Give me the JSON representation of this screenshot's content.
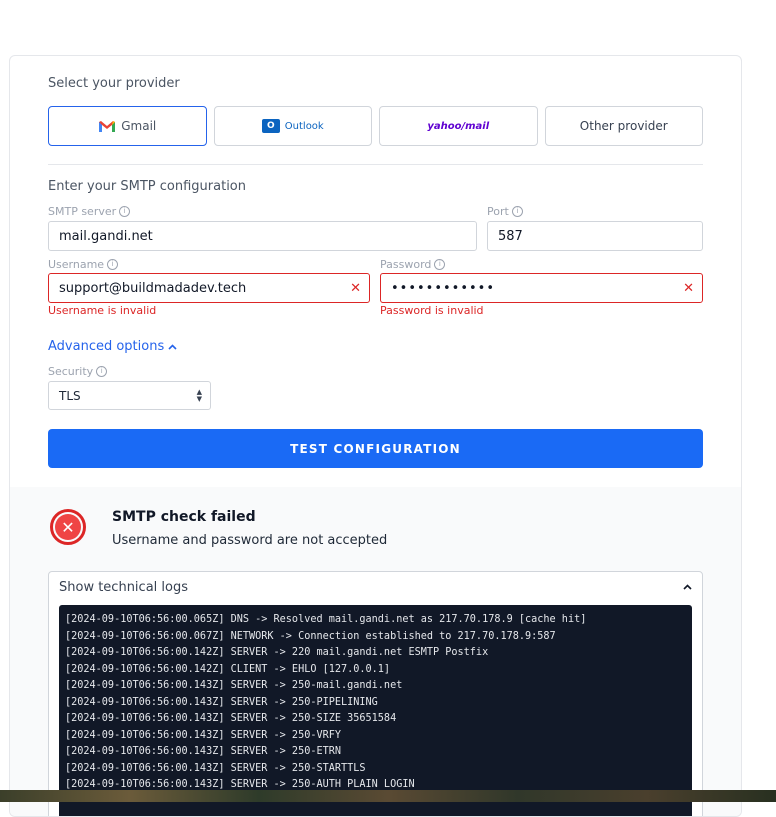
{
  "provider_section": {
    "label": "Select your provider",
    "options": [
      {
        "name": "Gmail",
        "selected": true
      },
      {
        "name": "Outlook",
        "selected": false
      },
      {
        "name": "yahoo/mail",
        "selected": false
      },
      {
        "name": "Other provider",
        "selected": false
      }
    ]
  },
  "smtp_section": {
    "label": "Enter your SMTP configuration",
    "server": {
      "label": "SMTP server",
      "value": "mail.gandi.net"
    },
    "port": {
      "label": "Port",
      "value": "587"
    },
    "username": {
      "label": "Username",
      "value": "support@buildmadadev.tech",
      "error": "Username is invalid"
    },
    "password": {
      "label": "Password",
      "value": "••••••••••••",
      "error": "Password is invalid"
    }
  },
  "advanced": {
    "toggle_label": "Advanced options",
    "security": {
      "label": "Security",
      "value": "TLS"
    }
  },
  "test_button": "TEST CONFIGURATION",
  "result": {
    "title": "SMTP check failed",
    "message": "Username and password are not accepted",
    "logs_toggle": "Show technical logs",
    "logs": [
      "[2024-09-10T06:56:00.065Z] DNS -> Resolved mail.gandi.net as 217.70.178.9 [cache hit]",
      "[2024-09-10T06:56:00.067Z] NETWORK -> Connection established to 217.70.178.9:587",
      "[2024-09-10T06:56:00.142Z] SERVER -> 220 mail.gandi.net ESMTP Postfix",
      "[2024-09-10T06:56:00.142Z] CLIENT -> EHLO [127.0.0.1]",
      "[2024-09-10T06:56:00.143Z] SERVER -> 250-mail.gandi.net",
      "[2024-09-10T06:56:00.143Z] SERVER -> 250-PIPELINING",
      "[2024-09-10T06:56:00.143Z] SERVER -> 250-SIZE 35651584",
      "[2024-09-10T06:56:00.143Z] SERVER -> 250-VRFY",
      "[2024-09-10T06:56:00.143Z] SERVER -> 250-ETRN",
      "[2024-09-10T06:56:00.143Z] SERVER -> 250-STARTTLS",
      "[2024-09-10T06:56:00.143Z] SERVER -> 250-AUTH PLAIN LOGIN"
    ]
  },
  "colors": {
    "accent": "#1a6af5",
    "error": "#dc2626",
    "terminal_bg": "#111827"
  }
}
